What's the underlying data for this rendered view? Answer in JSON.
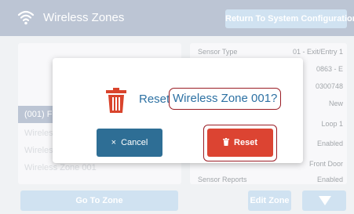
{
  "header": {
    "title": "Wireless Zones",
    "return_label": "Return To System Configuration"
  },
  "zone_list": {
    "selected_label": "(001) Fr",
    "rows": [
      "Wireless",
      "Wireless",
      "Wireless Zone 001"
    ]
  },
  "details": [
    {
      "label": "Sensor Type",
      "value": "01 - Exit/Entry 1"
    },
    {
      "label": "",
      "value": "0863 - E"
    },
    {
      "label": "",
      "value": "0300748"
    },
    {
      "label": "",
      "value": "New"
    },
    {
      "label": "",
      "value": "Loop 1"
    },
    {
      "label": "",
      "value": "Enabled"
    },
    {
      "label": "",
      "value": "Front Door"
    },
    {
      "label": "Sensor Reports",
      "value": "Enabled"
    }
  ],
  "dialog": {
    "prefix": "Reset",
    "zone_name": "Wireless Zone 001?",
    "cancel_label": "Cancel",
    "cancel_glyph": "×",
    "reset_label": "Reset"
  },
  "footer": {
    "go_to_zone_label": "Go To Zone",
    "edit_zone_label": "Edit Zone"
  },
  "colors": {
    "header": "#98a7bd",
    "light_button": "#b7d3ea",
    "cancel_button": "#2e6e95",
    "reset_button": "#dc4432",
    "trash_icon": "#d9442c",
    "highlight_outline": "#9a1c24",
    "dialog_text": "#2d71a3"
  },
  "icons": [
    "wifi-icon",
    "trash-icon",
    "close-icon",
    "chevron-down-icon"
  ]
}
